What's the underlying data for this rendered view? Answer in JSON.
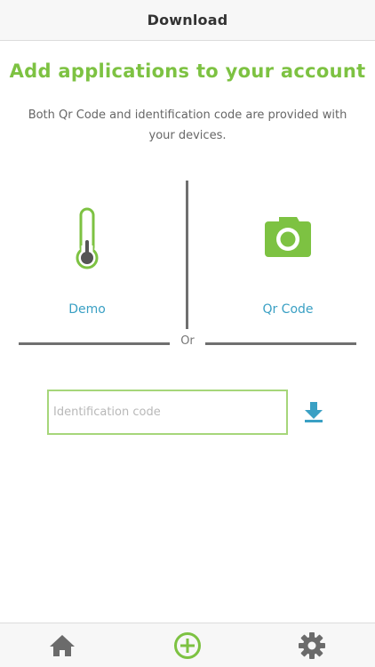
{
  "nav": {
    "title": "Download"
  },
  "main": {
    "heading": "Add applications to your account",
    "subtext": "Both Qr Code and identification code are provided with your devices.",
    "divider_label": "Or",
    "options": [
      {
        "label": "Demo",
        "icon": "thermometer-icon"
      },
      {
        "label": "Qr Code",
        "icon": "camera-icon"
      }
    ],
    "code_input": {
      "placeholder": "Identification code",
      "value": ""
    }
  },
  "tabbar": {
    "items": [
      {
        "icon": "home-icon",
        "active": false
      },
      {
        "icon": "add-circle-icon",
        "active": true
      },
      {
        "icon": "gear-icon",
        "active": false
      }
    ]
  },
  "colors": {
    "accent_green": "#7dc242",
    "accent_blue": "#3aa0c4",
    "divider_gray": "#6f6f6f",
    "inactive_tab_icon": "#6b6b6b"
  }
}
